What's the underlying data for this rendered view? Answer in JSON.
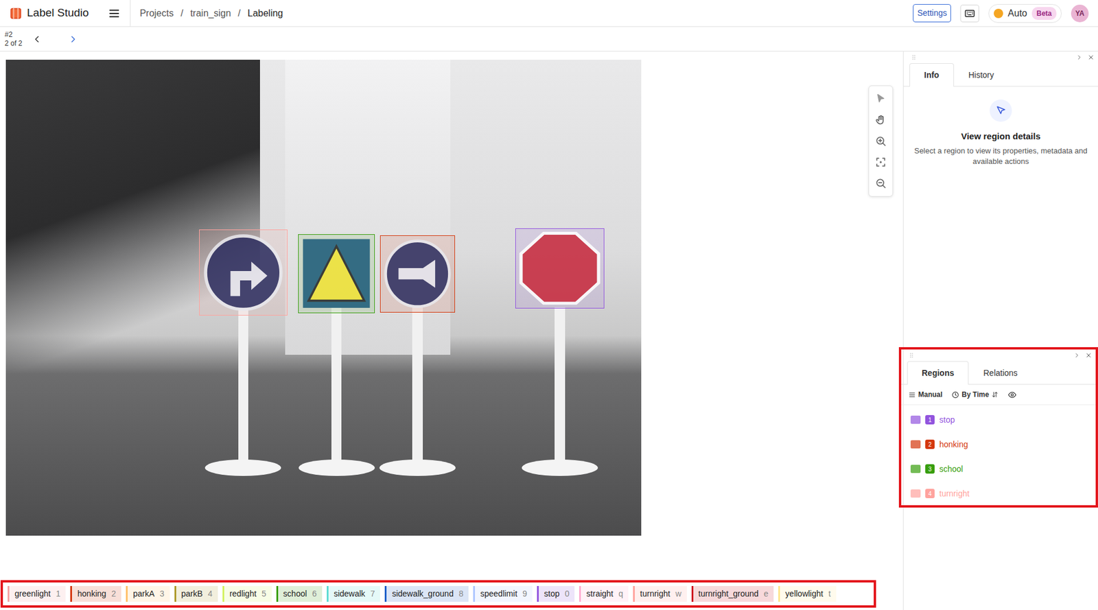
{
  "header": {
    "logo": "Label Studio",
    "breadcrumb": [
      {
        "label": "Projects"
      },
      {
        "label": "train_sign"
      },
      {
        "label": "Labeling"
      }
    ],
    "separator": "/",
    "settings": "Settings",
    "mode": {
      "label": "Auto",
      "badge": "Beta"
    },
    "avatar": "YA"
  },
  "task": {
    "id": "#2",
    "position": "2 of 2"
  },
  "info_panel": {
    "tabs": [
      {
        "label": "Info",
        "selected": true
      },
      {
        "label": "History",
        "selected": false
      }
    ],
    "title": "View region details",
    "text": "Select a region to view its properties, metadata and available actions"
  },
  "regions_panel": {
    "tabs": [
      {
        "label": "Regions",
        "selected": true
      },
      {
        "label": "Relations",
        "selected": false
      }
    ],
    "sort": "Manual",
    "order": "By Time",
    "items": [
      {
        "index": "1",
        "label": "stop",
        "color": "#9254de"
      },
      {
        "index": "2",
        "label": "honking",
        "color": "#d4380d"
      },
      {
        "index": "3",
        "label": "school",
        "color": "#389e0d"
      },
      {
        "index": "4",
        "label": "turnright",
        "color": "#ffa39e"
      }
    ]
  },
  "labels": [
    {
      "name": "greenlight",
      "hotkey": "1",
      "color": "#f5a3a3"
    },
    {
      "name": "honking",
      "hotkey": "2",
      "color": "#d4380d"
    },
    {
      "name": "parkA",
      "hotkey": "3",
      "color": "#ffc069"
    },
    {
      "name": "parkB",
      "hotkey": "4",
      "color": "#ad9a2b"
    },
    {
      "name": "redlight",
      "hotkey": "5",
      "color": "#d3f261"
    },
    {
      "name": "school",
      "hotkey": "6",
      "color": "#389e0d"
    },
    {
      "name": "sidewalk",
      "hotkey": "7",
      "color": "#5cdbd3"
    },
    {
      "name": "sidewalk_ground",
      "hotkey": "8",
      "color": "#1d5fc9"
    },
    {
      "name": "speedlimit",
      "hotkey": "9",
      "color": "#adc6ff"
    },
    {
      "name": "stop",
      "hotkey": "0",
      "color": "#9254de"
    },
    {
      "name": "straight",
      "hotkey": "q",
      "color": "#ffadd2"
    },
    {
      "name": "turnright",
      "hotkey": "w",
      "color": "#ffa39e"
    },
    {
      "name": "turnright_ground",
      "hotkey": "e",
      "color": "#cf1322"
    },
    {
      "name": "yellowlight",
      "hotkey": "t",
      "color": "#ffe58f"
    }
  ]
}
